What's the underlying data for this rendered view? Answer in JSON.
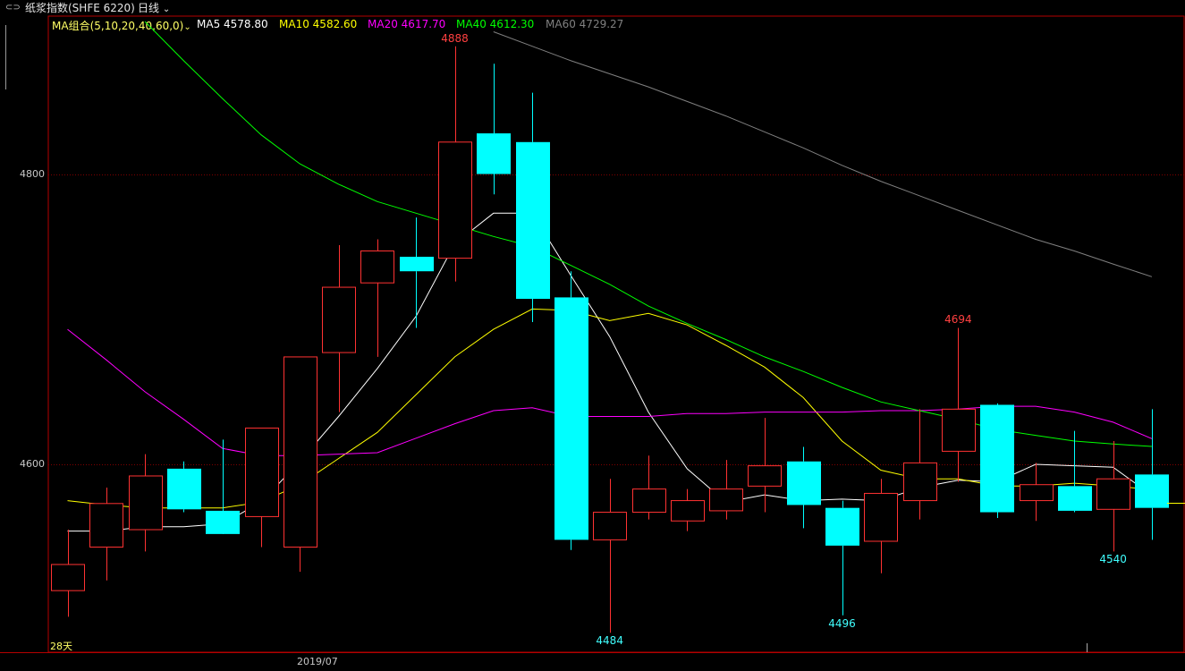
{
  "header": {
    "instrument": "纸浆指数(SHFE 6220)",
    "period": "日线",
    "link_icon": "link-icon",
    "dropdown_icon": "chevron-down-icon"
  },
  "legend": {
    "group_label": "MA组合(5,10,20,40,60,0)",
    "items": [
      {
        "name": "MA5",
        "value": "4578.80",
        "color": "#ffffff"
      },
      {
        "name": "MA10",
        "value": "4582.60",
        "color": "#ffff00"
      },
      {
        "name": "MA20",
        "value": "4617.70",
        "color": "#ff00ff"
      },
      {
        "name": "MA40",
        "value": "4612.30",
        "color": "#00ff00"
      },
      {
        "name": "MA60",
        "value": "4729.27",
        "color": "#808080"
      }
    ]
  },
  "axis": {
    "y_ticks": [
      4800,
      4600
    ],
    "x_label": "2019/07",
    "corner_label": "28天"
  },
  "colors": {
    "up": "#ff3232",
    "down": "#00ffff",
    "grid": "#800000",
    "frame": "#b40000"
  },
  "chart_data": {
    "type": "candlestick",
    "ylim": [
      4480,
      4908
    ],
    "candles": [
      {
        "o": 4513,
        "h": 4555,
        "l": 4495,
        "c": 4531
      },
      {
        "o": 4543,
        "h": 4584,
        "l": 4520,
        "c": 4573
      },
      {
        "o": 4555,
        "h": 4607,
        "l": 4540,
        "c": 4592
      },
      {
        "o": 4597,
        "h": 4602,
        "l": 4567,
        "c": 4569
      },
      {
        "o": 4568,
        "h": 4617,
        "l": 4570,
        "c": 4552
      },
      {
        "o": 4564,
        "h": 4595,
        "l": 4543,
        "c": 4625
      },
      {
        "o": 4543,
        "h": 4674,
        "l": 4526,
        "c": 4674
      },
      {
        "o": 4677,
        "h": 4751,
        "l": 4636,
        "c": 4722
      },
      {
        "o": 4725,
        "h": 4755,
        "l": 4674,
        "c": 4747
      },
      {
        "o": 4743,
        "h": 4770,
        "l": 4694,
        "c": 4733
      },
      {
        "o": 4742,
        "h": 4888,
        "l": 4726,
        "c": 4822
      },
      {
        "o": 4828,
        "h": 4876,
        "l": 4786,
        "c": 4800
      },
      {
        "o": 4822,
        "h": 4856,
        "l": 4698,
        "c": 4714
      },
      {
        "o": 4715,
        "h": 4733,
        "l": 4541,
        "c": 4548
      },
      {
        "o": 4548,
        "h": 4590,
        "l": 4484,
        "c": 4567
      },
      {
        "o": 4567,
        "h": 4606,
        "l": 4562,
        "c": 4583
      },
      {
        "o": 4561,
        "h": 4583,
        "l": 4554,
        "c": 4575
      },
      {
        "o": 4568,
        "h": 4603,
        "l": 4562,
        "c": 4583
      },
      {
        "o": 4585,
        "h": 4632,
        "l": 4567,
        "c": 4599
      },
      {
        "o": 4602,
        "h": 4612,
        "l": 4556,
        "c": 4572
      },
      {
        "o": 4570,
        "h": 4575,
        "l": 4496,
        "c": 4544
      },
      {
        "o": 4547,
        "h": 4590,
        "l": 4525,
        "c": 4580
      },
      {
        "o": 4575,
        "h": 4638,
        "l": 4562,
        "c": 4601
      },
      {
        "o": 4609,
        "h": 4694,
        "l": 4588,
        "c": 4638
      },
      {
        "o": 4641,
        "h": 4642,
        "l": 4563,
        "c": 4567
      },
      {
        "o": 4575,
        "h": 4601,
        "l": 4561,
        "c": 4586
      },
      {
        "o": 4585,
        "h": 4623,
        "l": 4567,
        "c": 4568
      },
      {
        "o": 4569,
        "h": 4616,
        "l": 4540,
        "c": 4590
      },
      {
        "o": 4593,
        "h": 4638,
        "l": 4548,
        "c": 4570
      }
    ],
    "ma": [
      {
        "name": "MA5",
        "values": [
          4554,
          4554,
          4557,
          4557,
          4559,
          4574,
          4602,
          4633,
          4666,
          4702,
          4752,
          4773,
          4773,
          4730,
          4688,
          4636,
          4597,
          4574,
          4579,
          4575,
          4576,
          4575,
          4584,
          4589,
          4588,
          4600,
          4599,
          4598,
          4578.8
        ]
      },
      {
        "name": "MA10",
        "values": [
          4575,
          4572,
          4570,
          4570,
          4570,
          4574,
          4586,
          4604,
          4622,
          4648,
          4674,
          4693,
          4707,
          4706,
          4699,
          4704,
          4696,
          4682,
          4667,
          4646,
          4616,
          4596,
          4590,
          4590,
          4585,
          4585,
          4587,
          4585,
          4582.6
        ]
      },
      {
        "name": "MA20",
        "values": [
          4693,
          4672,
          4650,
          4631,
          4611,
          4606,
          4606,
          4607,
          4608,
          4618,
          4628,
          4637,
          4639,
          4633,
          4633,
          4633,
          4635,
          4635,
          4636,
          4636,
          4636,
          4637,
          4637,
          4638,
          4640,
          4640,
          4636,
          4629,
          4617.7
        ]
      },
      {
        "name": "MA40",
        "values": [
          4905,
          4878,
          4852,
          4827,
          4807,
          4793,
          4781,
          4773,
          4765,
          4757,
          4750,
          4737,
          4724,
          4709,
          4697,
          4686,
          4674,
          4664,
          4653,
          4643,
          4637,
          4631,
          4624,
          4620,
          4616,
          4614,
          4612.3
        ]
      },
      {
        "name": "MA60",
        "values": [
          4898,
          4888,
          4878,
          4869,
          4860,
          4850,
          4840,
          4829,
          4818,
          4806,
          4795,
          4785,
          4775,
          4765,
          4755,
          4747,
          4738,
          4729.27
        ]
      }
    ],
    "labels": [
      {
        "candle": 10,
        "text": "4888",
        "type": "high"
      },
      {
        "candle": 23,
        "text": "4694",
        "type": "high"
      },
      {
        "candle": 14,
        "text": "4484",
        "type": "low"
      },
      {
        "candle": 20,
        "text": "4496",
        "type": "low"
      },
      {
        "candle": 27,
        "text": "4540",
        "type": "low"
      }
    ]
  }
}
